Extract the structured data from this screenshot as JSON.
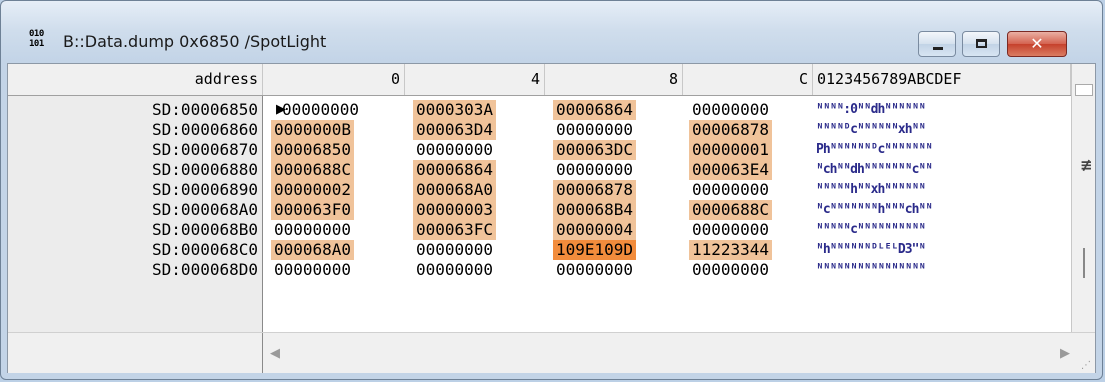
{
  "window": {
    "title": "B::Data.dump 0x6850 /SpotLight",
    "app_icon": "010\n101",
    "controls": {
      "minimize": "minimize",
      "maximize": "maximize",
      "close": "✕"
    }
  },
  "header": {
    "address": "address",
    "col0": "0",
    "col4": "4",
    "col8": "8",
    "colC": "C",
    "ascii": "0123456789ABCDEF"
  },
  "rows": [
    {
      "addr": "SD:00006850",
      "cells": [
        "00000000",
        "0000303A",
        "00006864",
        "00000000"
      ],
      "hl": [
        0,
        1,
        1,
        0
      ],
      "ascii": "ᴺᴺᴺᴺ:0ᴺᴺdhᴺᴺᴺᴺᴺᴺ"
    },
    {
      "addr": "SD:00006860",
      "cells": [
        "0000000B",
        "000063D4",
        "00000000",
        "00006878"
      ],
      "hl": [
        1,
        1,
        0,
        1
      ],
      "ascii": "ᴺᴺᴺᴺᴰcᴺᴺᴺᴺᴺᴺxhᴺᴺ"
    },
    {
      "addr": "SD:00006870",
      "cells": [
        "00006850",
        "00000000",
        "000063DC",
        "00000001"
      ],
      "hl": [
        1,
        0,
        1,
        1
      ],
      "ascii": "Phᴺᴺᴺᴺᴺᴺᴰcᴺᴺᴺᴺᴺᴺᴺ"
    },
    {
      "addr": "SD:00006880",
      "cells": [
        "0000688C",
        "00006864",
        "00000000",
        "000063E4"
      ],
      "hl": [
        1,
        1,
        0,
        1
      ],
      "ascii": "ᴺchᴺᴺdhᴺᴺᴺᴺᴺᴺᴺcᴺᴺ"
    },
    {
      "addr": "SD:00006890",
      "cells": [
        "00000002",
        "000068A0",
        "00006878",
        "00000000"
      ],
      "hl": [
        1,
        1,
        1,
        0
      ],
      "ascii": "ᴺᴺᴺᴺᴺhᴺᴺxhᴺᴺᴺᴺᴺᴺ"
    },
    {
      "addr": "SD:000068A0",
      "cells": [
        "000063F0",
        "00000003",
        "000068B4",
        "0000688C"
      ],
      "hl": [
        1,
        1,
        1,
        1
      ],
      "ascii": "ᴺcᴺᴺᴺᴺᴺᴺᴺhᴺᴺᴺchᴺᴺ"
    },
    {
      "addr": "SD:000068B0",
      "cells": [
        "00000000",
        "000063FC",
        "00000004",
        "00000000"
      ],
      "hl": [
        0,
        1,
        1,
        0
      ],
      "ascii": "ᴺᴺᴺᴺᴺcᴺᴺᴺᴺᴺᴺᴺᴺᴺᴺ"
    },
    {
      "addr": "SD:000068C0",
      "cells": [
        "000068A0",
        "00000000",
        "109E109D",
        "11223344"
      ],
      "hl": [
        1,
        0,
        2,
        1
      ],
      "ascii": "ᴺhᴺᴺᴺᴺᴺᴺᴰᴸᴱᴸD3\"ᴺ"
    },
    {
      "addr": "SD:000068D0",
      "cells": [
        "00000000",
        "00000000",
        "00000000",
        "00000000"
      ],
      "hl": [
        0,
        0,
        0,
        0
      ],
      "ascii": "ᴺᴺᴺᴺᴺᴺᴺᴺᴺᴺᴺᴺᴺᴺᴺᴺ"
    }
  ],
  "colors": {
    "highlight": "#f0c39a",
    "highlight_strong": "#f28c3c"
  }
}
